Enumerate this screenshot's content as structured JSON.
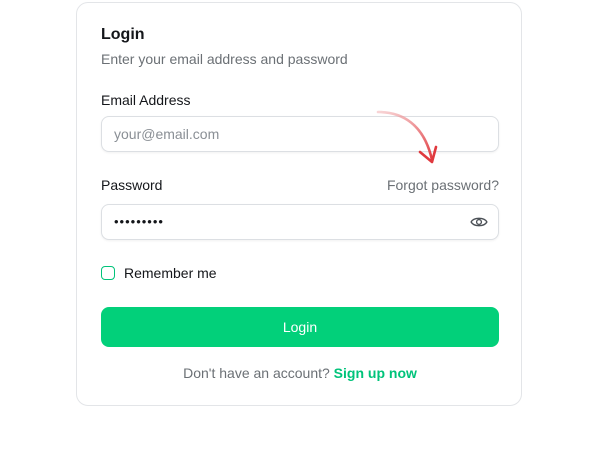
{
  "login": {
    "title": "Login",
    "subtitle": "Enter your email address and password",
    "email_label": "Email Address",
    "email_placeholder": "your@email.com",
    "email_value": "",
    "password_label": "Password",
    "forgot_link": "Forgot password?",
    "password_mask": "•••••••••",
    "remember_label": "Remember me",
    "remember_checked": false,
    "submit_label": "Login",
    "signup_prompt": "Don't have an account?",
    "signup_link": "Sign up now"
  },
  "colors": {
    "accent": "#02d07a",
    "link": "#00c37a",
    "annotation_arrow": "#e0393e"
  },
  "icons": {
    "password_toggle": "eye-icon",
    "annotation": "arrow-annotation-icon"
  }
}
